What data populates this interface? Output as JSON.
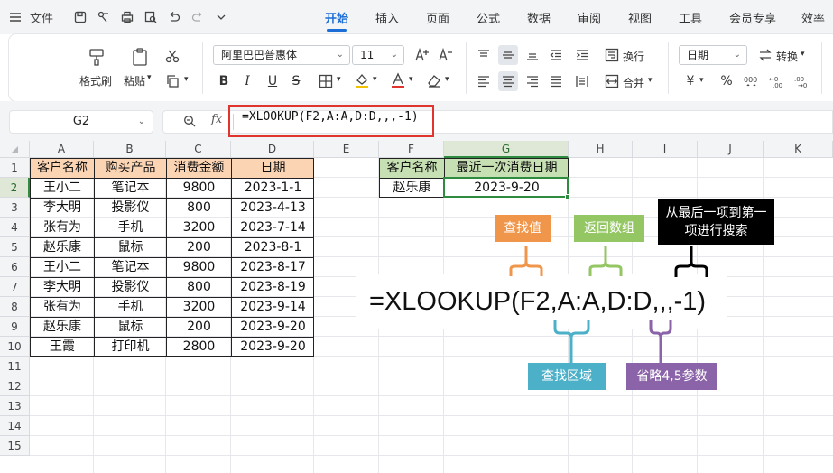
{
  "menubar": {
    "file_label": "文件",
    "tabs": [
      {
        "label": "开始",
        "active": true
      },
      {
        "label": "插入",
        "active": false
      },
      {
        "label": "页面",
        "active": false
      },
      {
        "label": "公式",
        "active": false
      },
      {
        "label": "数据",
        "active": false
      },
      {
        "label": "审阅",
        "active": false
      },
      {
        "label": "视图",
        "active": false
      },
      {
        "label": "工具",
        "active": false
      },
      {
        "label": "会员专享",
        "active": false
      },
      {
        "label": "效率",
        "active": false
      }
    ],
    "accent": "#1b6ed6"
  },
  "ribbon": {
    "format_painter_label": "格式刷",
    "paste_label": "粘贴",
    "font_name": "阿里巴巴普惠体",
    "font_size": "11",
    "bold_label": "B",
    "italic_label": "I",
    "underline_label": "U",
    "strike_label": "S",
    "wrap_label": "换行",
    "merge_label": "合并",
    "number_format": "日期",
    "convert_label": "转换",
    "currency_symbol": "¥",
    "percent_symbol": "%"
  },
  "formula_bar": {
    "name_box": "G2",
    "fx_label": "fx",
    "formula": "=XLOOKUP(F2,A:A,D:D,,,-1)",
    "highlight_color": "#e0342f"
  },
  "grid": {
    "columns": [
      "A",
      "B",
      "C",
      "D",
      "E",
      "F",
      "G",
      "H",
      "I",
      "J",
      "K"
    ],
    "selected_column": "G",
    "rows": [
      "1",
      "2",
      "3",
      "4",
      "5",
      "6",
      "7",
      "8",
      "9",
      "10",
      "11",
      "12",
      "13",
      "14",
      "15"
    ],
    "selected_row": "2"
  },
  "table": {
    "headers": [
      "客户名称",
      "购买产品",
      "消费金额",
      "日期"
    ],
    "header_color": "#fbd4b4",
    "rows": [
      [
        "王小二",
        "笔记本",
        "9800",
        "2023-1-1"
      ],
      [
        "李大明",
        "投影仪",
        "800",
        "2023-4-13"
      ],
      [
        "张有为",
        "手机",
        "3200",
        "2023-7-14"
      ],
      [
        "赵乐康",
        "鼠标",
        "200",
        "2023-8-1"
      ],
      [
        "王小二",
        "笔记本",
        "9800",
        "2023-8-17"
      ],
      [
        "李大明",
        "投影仪",
        "800",
        "2023-8-19"
      ],
      [
        "张有为",
        "手机",
        "3200",
        "2023-9-14"
      ],
      [
        "赵乐康",
        "鼠标",
        "200",
        "2023-9-20"
      ],
      [
        "王霞",
        "打印机",
        "2800",
        "2023-9-20"
      ]
    ]
  },
  "lookup": {
    "headers": [
      "客户名称",
      "最近一次消费日期"
    ],
    "header_color": "#c6dfb3",
    "customer": "赵乐康",
    "result": "2023-9-20"
  },
  "annotations": {
    "formula_display": "=XLOOKUP(F2,A:A,D:D,,,-1)",
    "labels": [
      {
        "text": "查找值",
        "color": "#f0964b"
      },
      {
        "text": "返回数组",
        "color": "#94c664"
      },
      {
        "text": "从最后一项到第一项进行搜索",
        "color": "#000000"
      },
      {
        "text": "查找区域",
        "color": "#4bb0c8"
      },
      {
        "text": "省略4,5参数",
        "color": "#8a63a8"
      }
    ]
  }
}
